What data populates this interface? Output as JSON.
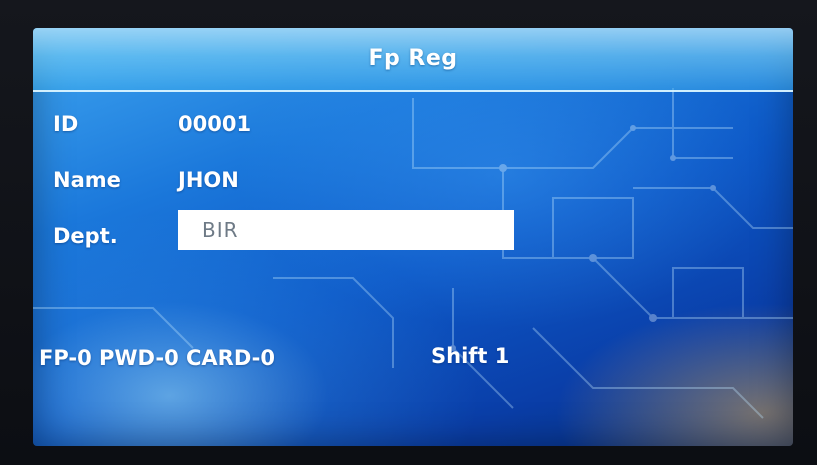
{
  "window": {
    "title": "Fp Reg"
  },
  "form": {
    "id_label": "ID",
    "id_value": "00001",
    "name_label": "Name",
    "name_value": "JHON",
    "dept_label": "Dept.",
    "dept_value": "BIR"
  },
  "status": {
    "counters": "FP-0 PWD-0 CARD-0",
    "shift": "Shift 1"
  },
  "colors": {
    "screen_blue": "#1b78db",
    "title_bar": "#8fd3f5",
    "text": "#ffffff",
    "input_bg": "#ffffff",
    "input_text": "#6e7a86"
  }
}
